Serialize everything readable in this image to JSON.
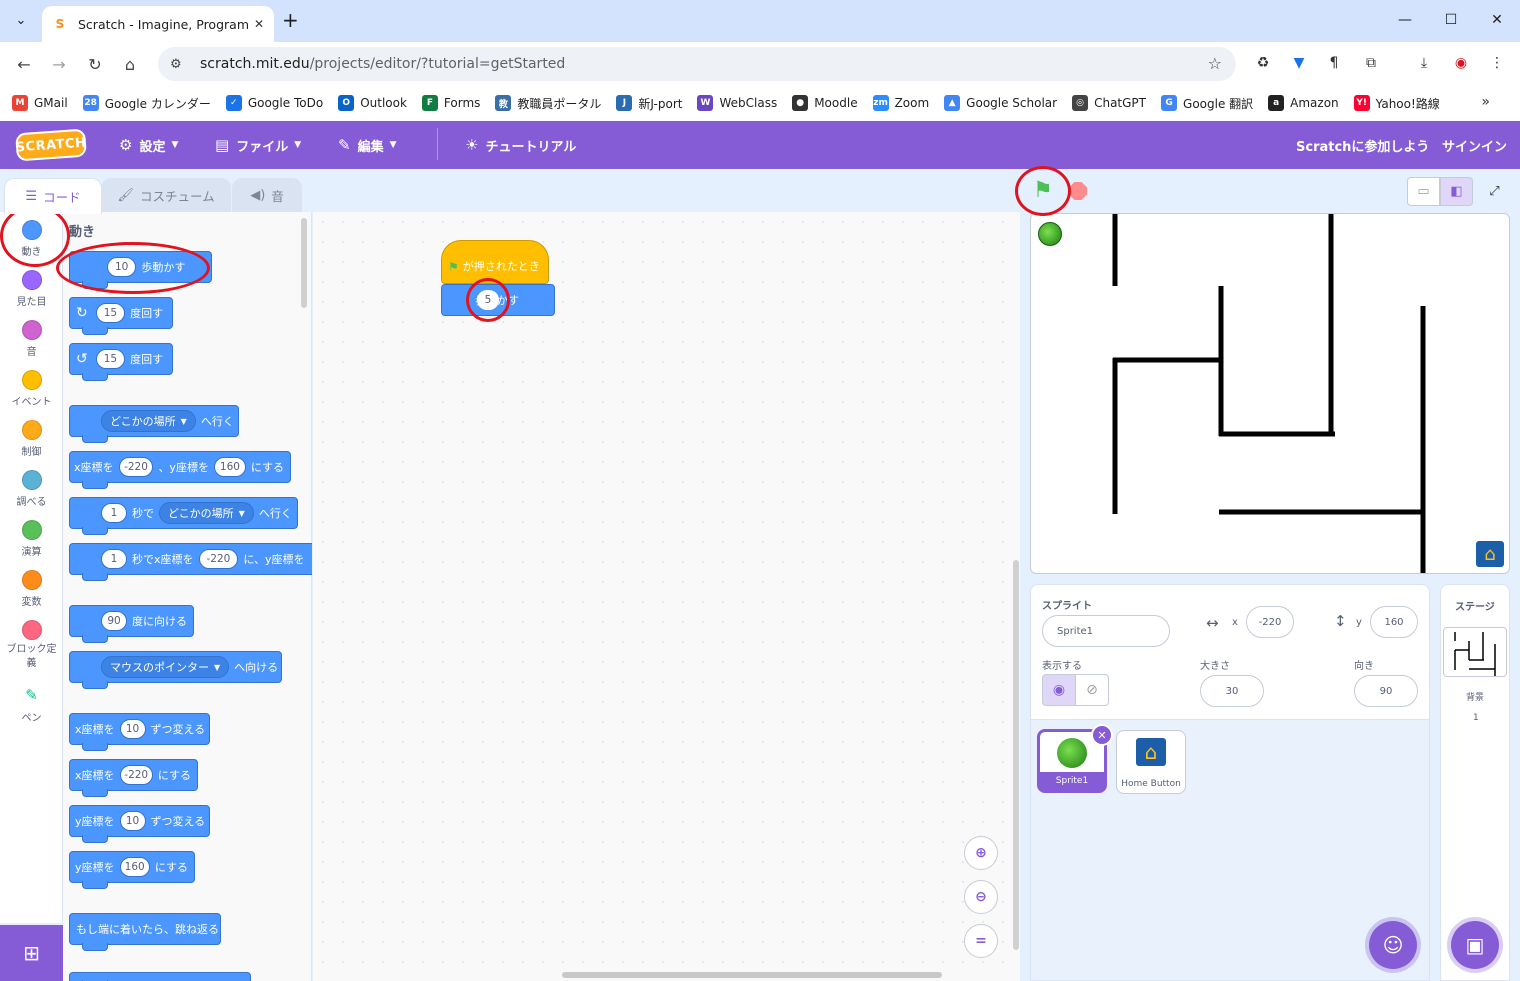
{
  "browser": {
    "tab_title": "Scratch - Imagine, Program, Sha",
    "url_host": "scratch.mit.edu",
    "url_path": "/projects/editor/?tutorial=getStarted"
  },
  "bookmarks": [
    {
      "label": "GMail",
      "color": "#ea4335",
      "glyph": "M"
    },
    {
      "label": "Google カレンダー",
      "color": "#4285f4",
      "glyph": "28"
    },
    {
      "label": "Google ToDo",
      "color": "#1a73e8",
      "glyph": "✓"
    },
    {
      "label": "Outlook",
      "color": "#0a64c8",
      "glyph": "O"
    },
    {
      "label": "Forms",
      "color": "#107c41",
      "glyph": "F"
    },
    {
      "label": "教職員ポータル",
      "color": "#3a6ea5",
      "glyph": "教"
    },
    {
      "label": "新J-port",
      "color": "#2b6cb0",
      "glyph": "J"
    },
    {
      "label": "WebClass",
      "color": "#6b46c1",
      "glyph": "W"
    },
    {
      "label": "Moodle",
      "color": "#333333",
      "glyph": "●"
    },
    {
      "label": "Zoom",
      "color": "#2d8cff",
      "glyph": "zm"
    },
    {
      "label": "Google Scholar",
      "color": "#4285f4",
      "glyph": "▲"
    },
    {
      "label": "ChatGPT",
      "color": "#444444",
      "glyph": "◎"
    },
    {
      "label": "Google 翻訳",
      "color": "#4285f4",
      "glyph": "G"
    },
    {
      "label": "Amazon",
      "color": "#222222",
      "glyph": "a"
    },
    {
      "label": "Yahoo!路線",
      "color": "#ff0033",
      "glyph": "Y!"
    }
  ],
  "menubar": {
    "logo": "SCRATCH",
    "settings": "設定",
    "file": "ファイル",
    "edit": "編集",
    "tutorial": "チュートリアル",
    "join": "Scratchに参加しよう",
    "signin": "サインイン"
  },
  "editor_tabs": {
    "code": "コード",
    "costumes": "コスチューム",
    "sounds": "音"
  },
  "categories": [
    {
      "label": "動き",
      "color": "#4c97ff"
    },
    {
      "label": "見た目",
      "color": "#9966ff"
    },
    {
      "label": "音",
      "color": "#cf63cf"
    },
    {
      "label": "イベント",
      "color": "#ffbf00"
    },
    {
      "label": "制御",
      "color": "#ffab19"
    },
    {
      "label": "調べる",
      "color": "#5cb1d6"
    },
    {
      "label": "演算",
      "color": "#59c059"
    },
    {
      "label": "変数",
      "color": "#ff8c1a"
    },
    {
      "label": "ブロック定義",
      "color": "#ff6680"
    },
    {
      "label": "ペン",
      "color": "#0fbd8c"
    }
  ],
  "palette": {
    "title": "動き",
    "move_steps": "10",
    "move_label": "歩動かす",
    "turn_right": "15",
    "turn_left": "15",
    "turn_label": "度回す",
    "goto_target": "どこかの場所",
    "goto_label": "へ行く",
    "goxy_x_label": "x座標を",
    "goxy_x": "-220",
    "goxy_y_label": "、y座標を",
    "goxy_y": "160",
    "goxy_end": "にする",
    "glide_secs": "1",
    "glide_label": "秒で",
    "glide_target": "どこかの場所",
    "glide_end": "へ行く",
    "glidexy_secs": "1",
    "glidexy_label": "秒でx座標を",
    "glidexy_x": "-220",
    "glidexy_mid": "に、y座標を",
    "point_dir": "90",
    "point_label": "度に向ける",
    "point_towards": "マウスのポインター",
    "point_towards_label": "へ向ける",
    "changex_label": "x座標を",
    "changex_val": "10",
    "changex_end": "ずつ変える",
    "setx_label": "x座標を",
    "setx_val": "-220",
    "setx_end": "にする",
    "changey_label": "y座標を",
    "changey_val": "10",
    "changey_end": "ずつ変える",
    "sety_label": "y座標を",
    "sety_val": "160",
    "sety_end": "にする",
    "bounce": "もし端に着いたら、跳ね返る"
  },
  "script": {
    "hat_label": "が押されたとき",
    "move_value": "5",
    "move_label": "歩動かす"
  },
  "sprite_info": {
    "section": "スプライト",
    "name": "Sprite1",
    "x_label": "x",
    "x": "-220",
    "y_label": "y",
    "y": "160",
    "show_label": "表示する",
    "size_label": "大きさ",
    "size": "30",
    "direction_label": "向き",
    "direction": "90"
  },
  "sprites": [
    {
      "name": "Sprite1"
    },
    {
      "name": "Home Button"
    }
  ],
  "stage_panel": {
    "title": "ステージ",
    "backdrop_label": "背景",
    "backdrop_count": "1"
  }
}
